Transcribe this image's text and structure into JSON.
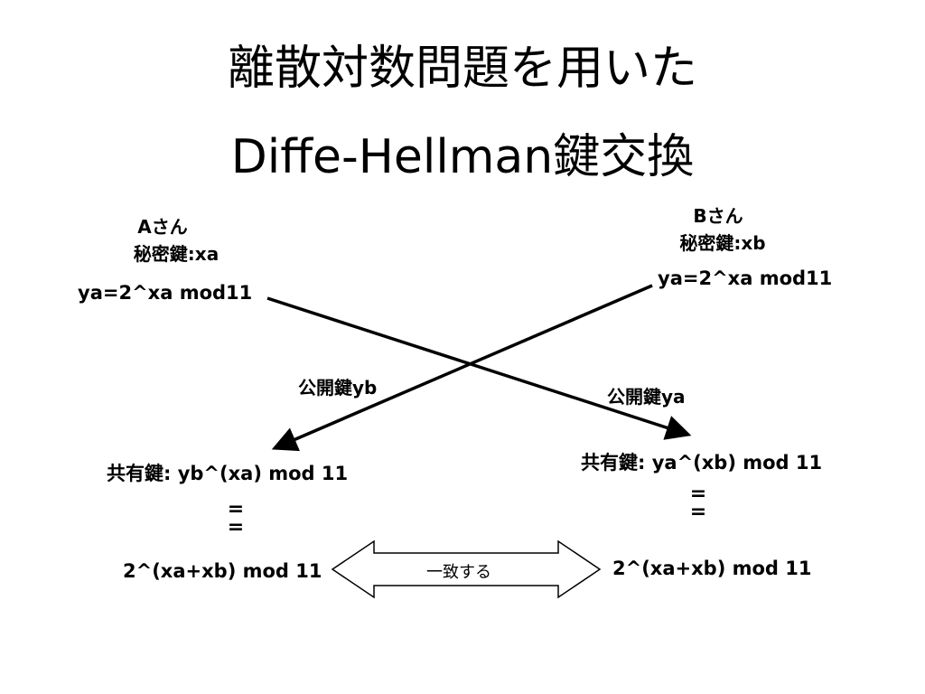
{
  "title": {
    "line1": "離散対数問題を用いた",
    "line2": "Diffe-Hellman鍵交換"
  },
  "party_a": {
    "name": "Aさん",
    "secret": "秘密鍵:xa",
    "public_formula": "ya=2^xa mod11",
    "shared_key": "共有鍵: yb^(xa) mod 11",
    "equals_sign": "=",
    "result": "2^(xa+xb) mod 11"
  },
  "party_b": {
    "name": "Bさん",
    "secret": "秘密鍵:xb",
    "public_formula": "ya=2^xa mod11",
    "shared_key": "共有鍵: ya^(xb) mod 11",
    "equals_sign": "=",
    "result": "2^(xa+xb) mod 11"
  },
  "exchange": {
    "to_a_label": "公開鍵yb",
    "to_b_label": "公開鍵ya"
  },
  "match_label": "一致する"
}
